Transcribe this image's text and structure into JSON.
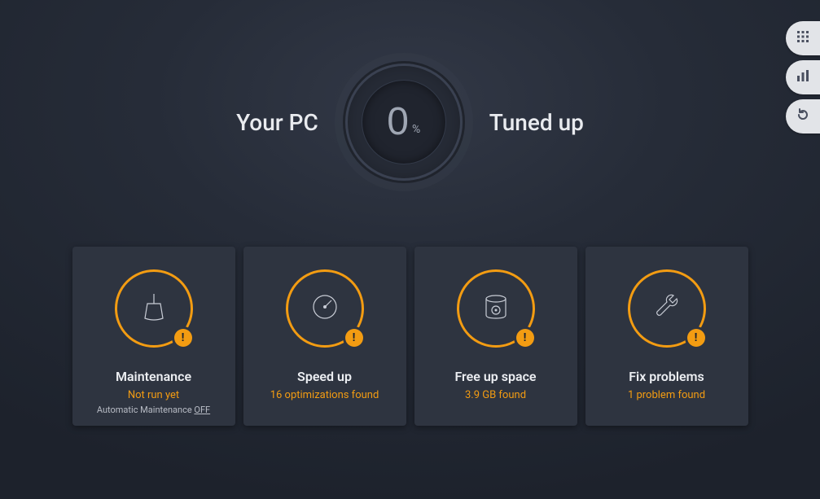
{
  "header": {
    "left_label": "Your PC",
    "right_label": "Tuned up",
    "gauge_value": "0",
    "gauge_unit": "%"
  },
  "side_buttons": {
    "apps_icon": "apps",
    "stats_icon": "stats",
    "rescan_icon": "rescan"
  },
  "cards": {
    "maintenance": {
      "title": "Maintenance",
      "status": "Not run yet",
      "sub_prefix": "Automatic Maintenance ",
      "sub_value": "OFF",
      "badge": "!"
    },
    "speedup": {
      "title": "Speed up",
      "status": "16 optimizations found",
      "badge": "!"
    },
    "freeup": {
      "title": "Free up space",
      "status": "3.9 GB found",
      "badge": "!"
    },
    "fix": {
      "title": "Fix problems",
      "status": "1 problem found",
      "badge": "!"
    }
  }
}
